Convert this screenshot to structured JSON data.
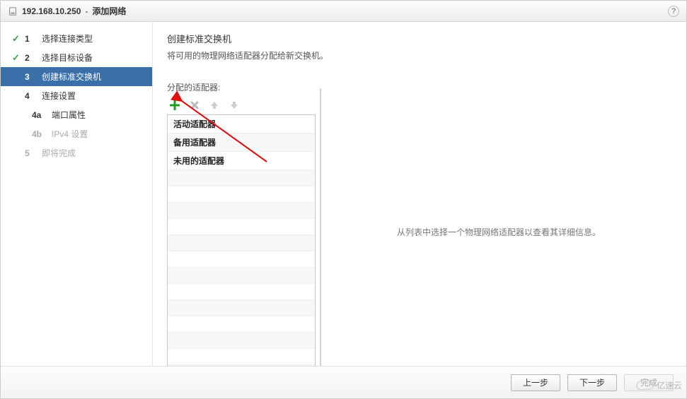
{
  "titlebar": {
    "ip": "192.168.10.250",
    "sep": " - ",
    "action": "添加网络",
    "help": "?"
  },
  "steps": {
    "s1": {
      "num": "1",
      "label": "选择连接类型",
      "done": true
    },
    "s2": {
      "num": "2",
      "label": "选择目标设备",
      "done": true
    },
    "s3": {
      "num": "3",
      "label": "创建标准交换机",
      "active": true
    },
    "s4": {
      "num": "4",
      "label": "连接设置"
    },
    "s4a": {
      "num": "4a",
      "label": "端口属性"
    },
    "s4b": {
      "num": "4b",
      "label": "IPv4 设置",
      "disabled": true
    },
    "s5": {
      "num": "5",
      "label": "即将完成",
      "disabled": true
    }
  },
  "content": {
    "heading": "创建标准交换机",
    "subheading": "将可用的物理网络适配器分配给新交换机。",
    "assigned_label": "分配的适配器:",
    "groups": {
      "active": "活动适配器",
      "standby": "备用适配器",
      "unused": "未用的适配器"
    },
    "right_placeholder": "从列表中选择一个物理网络适配器以查看其详细信息。"
  },
  "toolbar": {
    "add_enabled": true,
    "remove_enabled": false,
    "up_enabled": false,
    "down_enabled": false
  },
  "footer": {
    "back": "上一步",
    "next": "下一步",
    "finish": "完成",
    "finish_enabled": false
  },
  "watermark": "亿速云"
}
